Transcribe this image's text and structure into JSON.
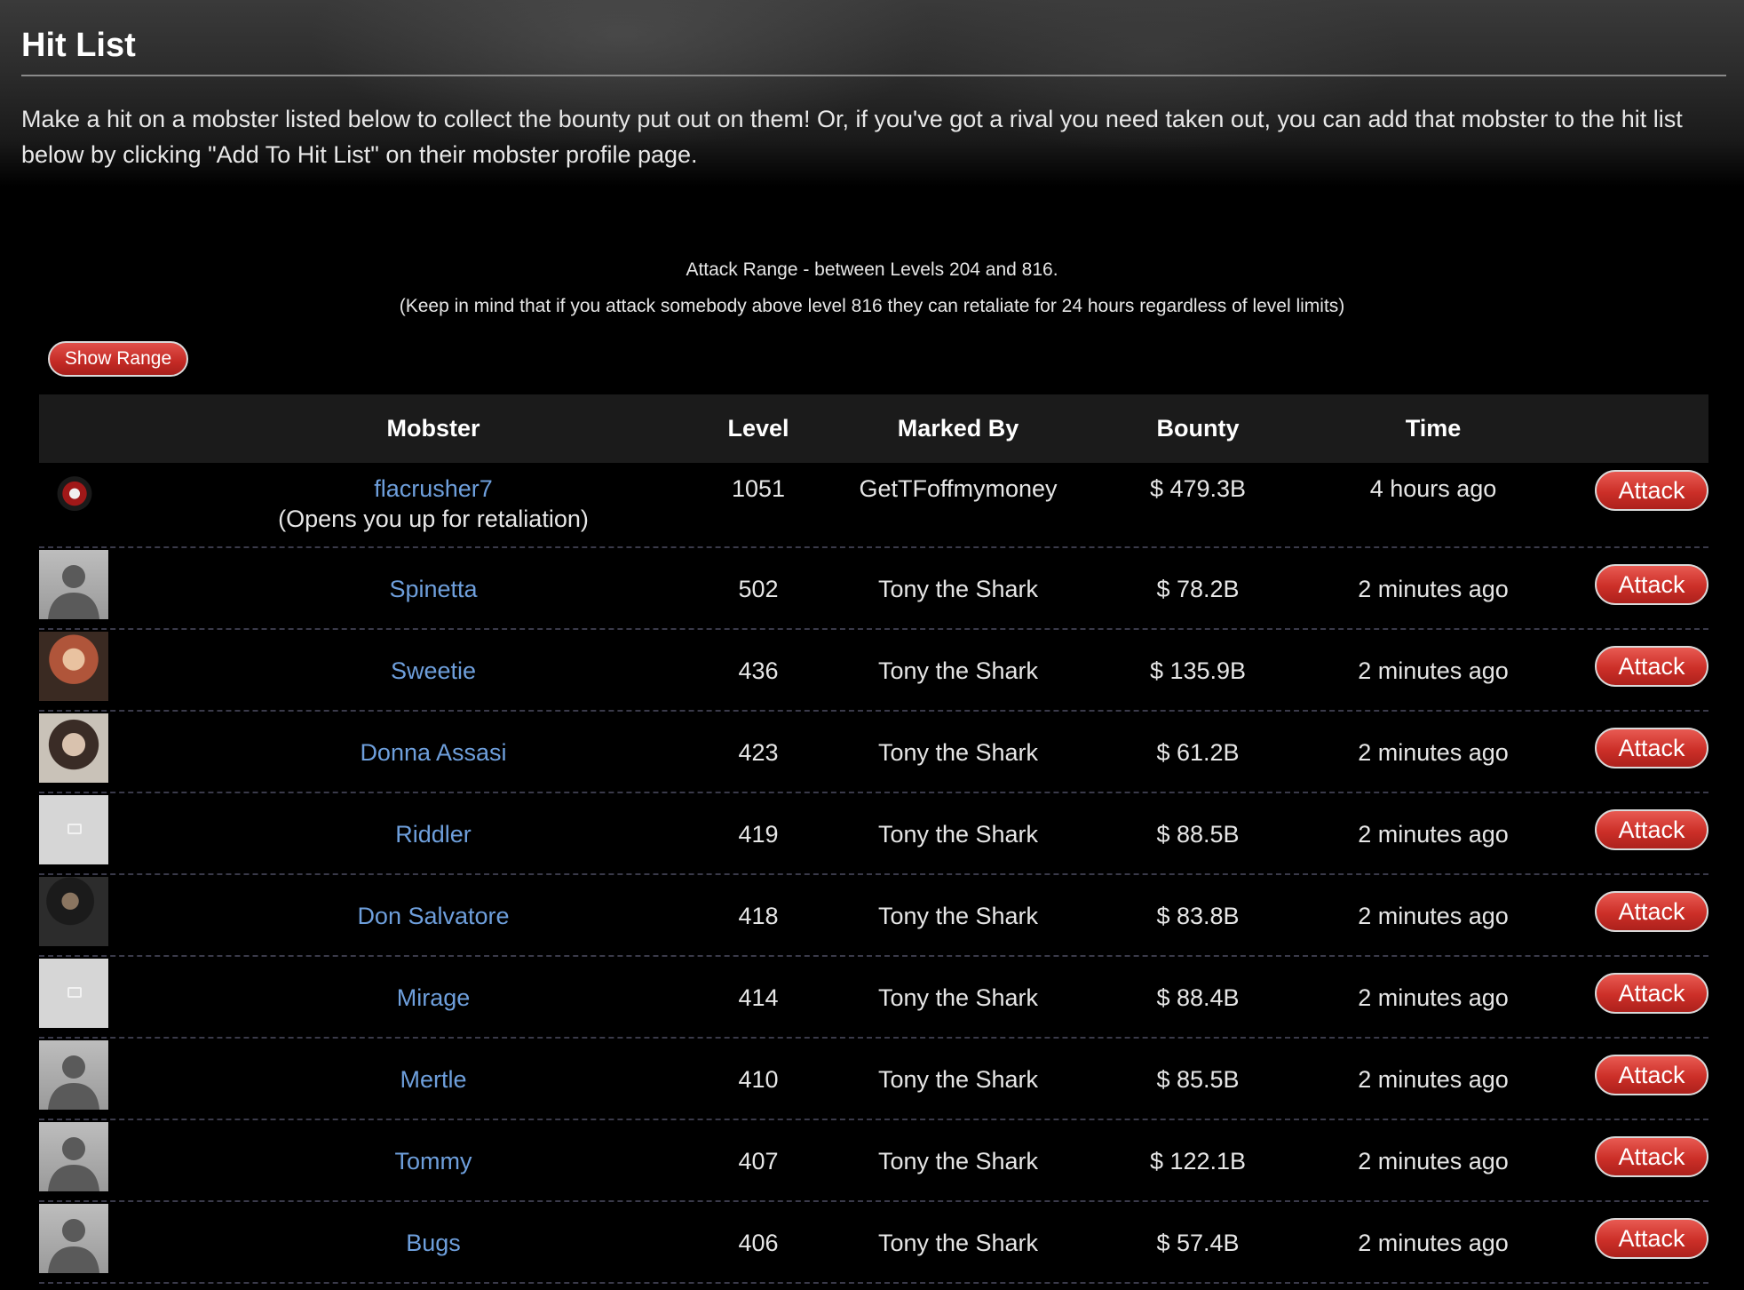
{
  "header": {
    "title": "Hit List",
    "intro": "Make a hit on a mobster listed below to collect the bounty put out on them! Or, if you've got a rival you need taken out, you can add that mobster to the hit list below by clicking \"Add To Hit List\" on their mobster profile page."
  },
  "range": {
    "line1": "Attack Range - between Levels 204 and 816.",
    "line2": "(Keep in mind that if you attack somebody above level 816 they can retaliate for 24 hours regardless of level limits)",
    "show_range_label": "Show Range"
  },
  "table": {
    "columns": {
      "mobster": "Mobster",
      "level": "Level",
      "marked_by": "Marked By",
      "bounty": "Bounty",
      "time": "Time"
    },
    "rows": [
      {
        "avatar": "skull-avatar",
        "name": "flacrusher7",
        "note": "(Opens you up for retaliation)",
        "level": "1051",
        "marked_by": "GetTFoffmymoney",
        "bounty": "$ 479.3B",
        "time": "4 hours ago",
        "action": "Attack"
      },
      {
        "avatar": "silhouette-avatar",
        "name": "Spinetta",
        "level": "502",
        "marked_by": "Tony the Shark",
        "bounty": "$ 78.2B",
        "time": "2 minutes ago",
        "action": "Attack"
      },
      {
        "avatar": "photo-avatar",
        "name": "Sweetie",
        "level": "436",
        "marked_by": "Tony the Shark",
        "bounty": "$ 135.9B",
        "time": "2 minutes ago",
        "action": "Attack"
      },
      {
        "avatar": "photo-avatar",
        "name": "Donna Assasi",
        "level": "423",
        "marked_by": "Tony the Shark",
        "bounty": "$ 61.2B",
        "time": "2 minutes ago",
        "action": "Attack"
      },
      {
        "avatar": "placeholder-avatar",
        "name": "Riddler",
        "level": "419",
        "marked_by": "Tony the Shark",
        "bounty": "$ 88.5B",
        "time": "2 minutes ago",
        "action": "Attack"
      },
      {
        "avatar": "photo-avatar",
        "name": "Don Salvatore",
        "level": "418",
        "marked_by": "Tony the Shark",
        "bounty": "$ 83.8B",
        "time": "2 minutes ago",
        "action": "Attack"
      },
      {
        "avatar": "placeholder-avatar",
        "name": "Mirage",
        "level": "414",
        "marked_by": "Tony the Shark",
        "bounty": "$ 88.4B",
        "time": "2 minutes ago",
        "action": "Attack"
      },
      {
        "avatar": "silhouette-avatar",
        "name": "Mertle",
        "level": "410",
        "marked_by": "Tony the Shark",
        "bounty": "$ 85.5B",
        "time": "2 minutes ago",
        "action": "Attack"
      },
      {
        "avatar": "silhouette-avatar",
        "name": "Tommy",
        "level": "407",
        "marked_by": "Tony the Shark",
        "bounty": "$ 122.1B",
        "time": "2 minutes ago",
        "action": "Attack"
      },
      {
        "avatar": "silhouette-avatar",
        "name": "Bugs",
        "level": "406",
        "marked_by": "Tony the Shark",
        "bounty": "$ 57.4B",
        "time": "2 minutes ago",
        "action": "Attack"
      }
    ]
  },
  "colors": {
    "link": "#6e9fdc",
    "button": "#cc2f28",
    "header_row": "#1b1b1b"
  }
}
